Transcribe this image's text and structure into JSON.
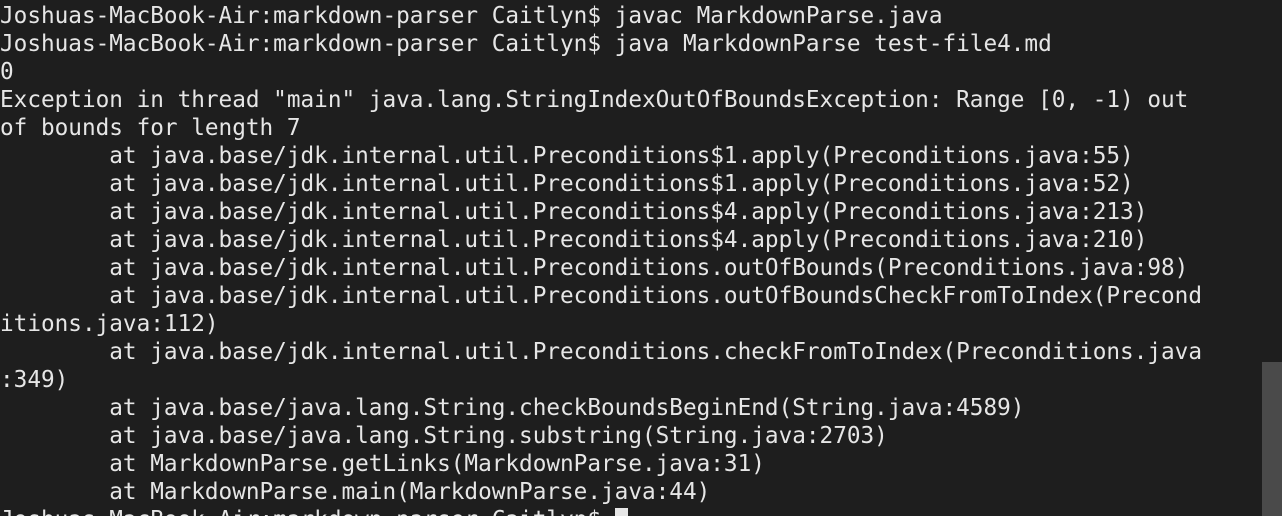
{
  "terminal": {
    "lines": [
      "Joshuas-MacBook-Air:markdown-parser Caitlyn$ javac MarkdownParse.java",
      "Joshuas-MacBook-Air:markdown-parser Caitlyn$ java MarkdownParse test-file4.md",
      "0",
      "Exception in thread \"main\" java.lang.StringIndexOutOfBoundsException: Range [0, -1) out",
      "of bounds for length 7",
      "        at java.base/jdk.internal.util.Preconditions$1.apply(Preconditions.java:55)",
      "        at java.base/jdk.internal.util.Preconditions$1.apply(Preconditions.java:52)",
      "        at java.base/jdk.internal.util.Preconditions$4.apply(Preconditions.java:213)",
      "        at java.base/jdk.internal.util.Preconditions$4.apply(Preconditions.java:210)",
      "        at java.base/jdk.internal.util.Preconditions.outOfBounds(Preconditions.java:98)",
      "        at java.base/jdk.internal.util.Preconditions.outOfBoundsCheckFromToIndex(Precond",
      "itions.java:112)",
      "        at java.base/jdk.internal.util.Preconditions.checkFromToIndex(Preconditions.java",
      ":349)",
      "        at java.base/java.lang.String.checkBoundsBeginEnd(String.java:4589)",
      "        at java.base/java.lang.String.substring(String.java:2703)",
      "        at MarkdownParse.getLinks(MarkdownParse.java:31)",
      "        at MarkdownParse.main(MarkdownParse.java:44)"
    ],
    "prompt": "Joshuas-MacBook-Air:markdown-parser Caitlyn$ "
  },
  "colors": {
    "background": "#1e1e1e",
    "foreground": "#e6e6e6",
    "scrollbar_thumb": "#4a4a4a"
  }
}
